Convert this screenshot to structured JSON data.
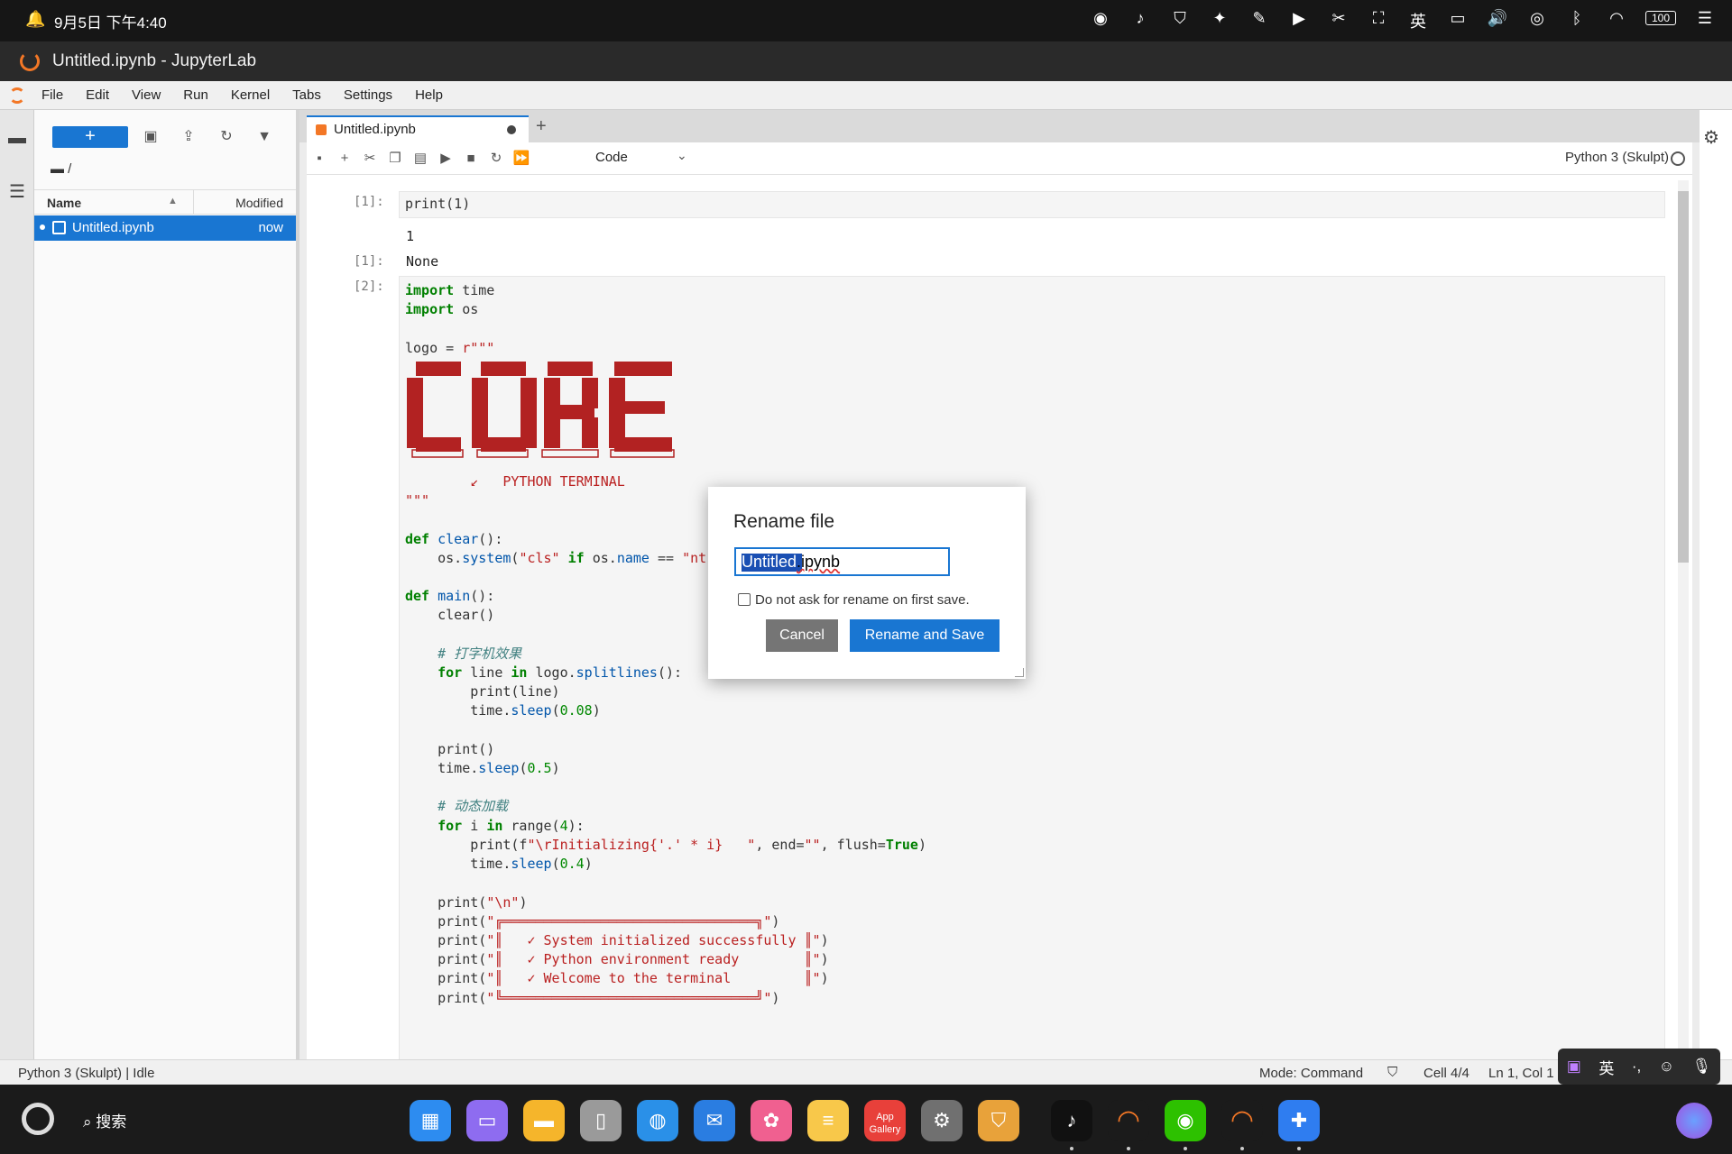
{
  "statusbar": {
    "datetime": "9月5日 下午4:40",
    "battery": "100",
    "icons": [
      "wechat-icon",
      "tiktok-icon",
      "shield-app-icon",
      "assistant-icon",
      "note-icon",
      "camera-icon",
      "screenshot-icon",
      "screen-record-icon",
      "keyboard-lang-icon",
      "cast-icon",
      "volume-icon",
      "nfc-icon",
      "bluetooth-icon",
      "wifi-icon",
      "battery-icon",
      "settings-toggle-icon"
    ]
  },
  "window": {
    "title": "Untitled.ipynb - JupyterLab"
  },
  "menu": {
    "items": [
      "File",
      "Edit",
      "View",
      "Run",
      "Kernel",
      "Tabs",
      "Settings",
      "Help"
    ]
  },
  "filebrowser": {
    "new_button": "+",
    "breadcrumb": "/",
    "columns": {
      "name": "Name",
      "modified": "Modified"
    },
    "files": [
      {
        "name": "Untitled.ipynb",
        "modified": "now",
        "selected": true
      }
    ]
  },
  "notebook": {
    "tab_label": "Untitled.ipynb",
    "cell_type": "Code",
    "kernel": "Python 3 (Skulpt)",
    "cells": [
      {
        "prompt": "[1]:",
        "source": "print(1)",
        "stdout": "1",
        "out_prompt": "[1]:",
        "result": "None"
      },
      {
        "prompt": "[2]:"
      }
    ],
    "logo_caption": "PYTHON TERMINAL"
  },
  "footer": {
    "left": "Python 3 (Skulpt) | Idle",
    "mode": "Mode: Command",
    "cell": "Cell 4/4",
    "ln": "Ln 1, Col 1"
  },
  "ime": {
    "lang": "英"
  },
  "dock": {
    "search_label": "搜索",
    "apps": [
      {
        "name": "app-grid",
        "color": "#2d8cf0"
      },
      {
        "name": "files-app",
        "color": "#8e6cf0"
      },
      {
        "name": "folder-app",
        "color": "#f5b52b"
      },
      {
        "name": "trash-app",
        "color": "#9a9a9a"
      },
      {
        "name": "browser-app",
        "color": "#2a90e8"
      },
      {
        "name": "mail-app",
        "color": "#2a7de1"
      },
      {
        "name": "photos-app",
        "color": "#f06090"
      },
      {
        "name": "notes-app",
        "color": "#f8c84a"
      },
      {
        "name": "appgallery-app",
        "color": "#e8403a"
      },
      {
        "name": "settings-app",
        "color": "#707070"
      },
      {
        "name": "security-app",
        "color": "#e8a23a"
      },
      {
        "name": "tiktok-app",
        "color": "#111111"
      },
      {
        "name": "jupyter-app",
        "color": "#1b1b1b"
      },
      {
        "name": "wechat-app",
        "color": "#2dc100"
      },
      {
        "name": "jupyter-app-2",
        "color": "#1b1b1b"
      },
      {
        "name": "extensions-app",
        "color": "#2f7df0"
      }
    ]
  },
  "dialog": {
    "title": "Rename file",
    "input_selected": "Untitled",
    "input_rest": ".ipynb",
    "checkbox_label": "Do not ask for rename on first save.",
    "cancel": "Cancel",
    "confirm": "Rename and Save"
  },
  "colors": {
    "accent": "#1976d2",
    "jupyter_orange": "#f37726",
    "logo_red": "#b22222"
  }
}
